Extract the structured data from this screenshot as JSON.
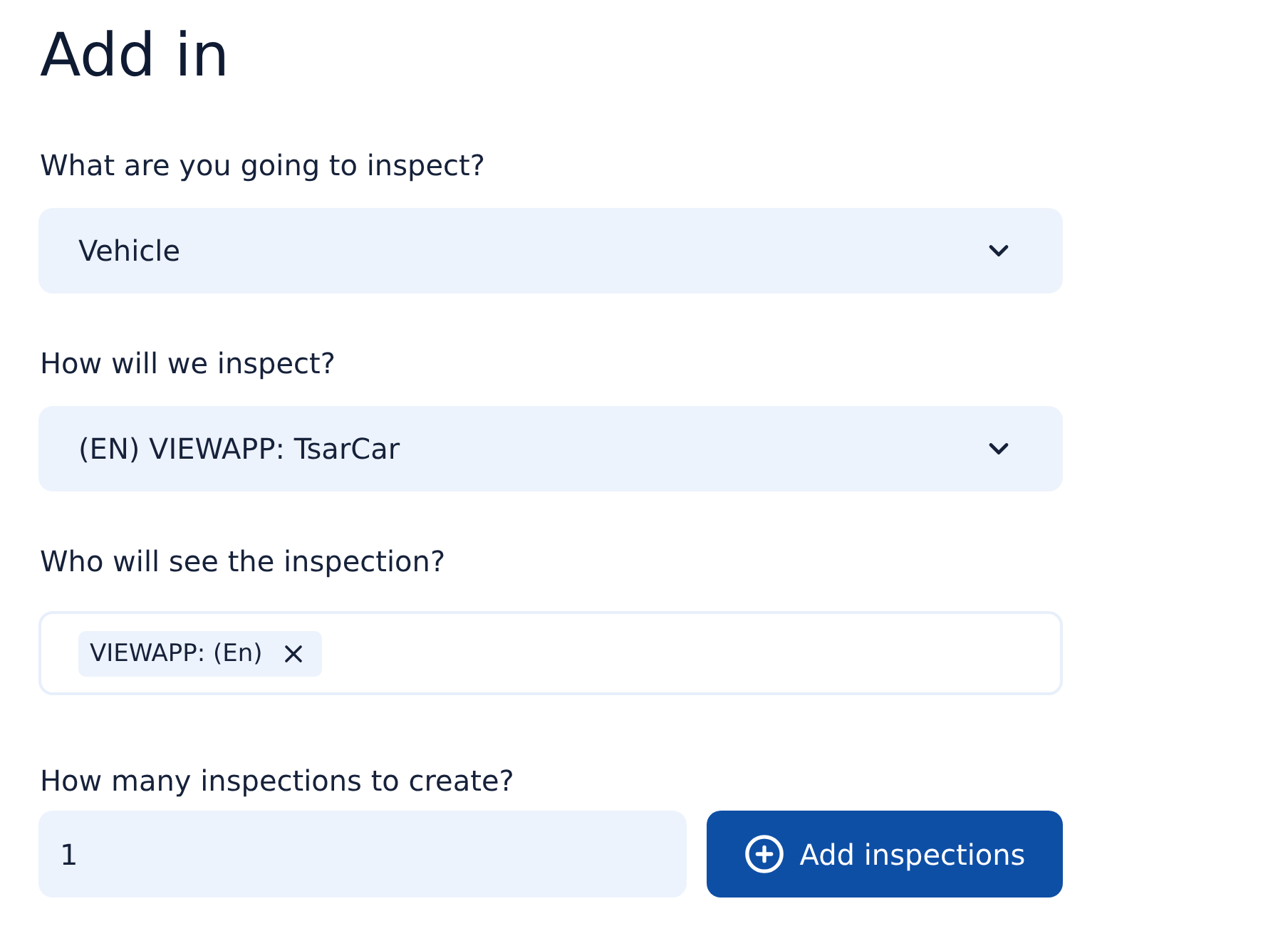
{
  "title": "Add in",
  "fields": [
    {
      "kind": "select",
      "label": "What are you going to inspect?",
      "value": "Vehicle"
    },
    {
      "kind": "select",
      "label": "How will we inspect?",
      "value": "(EN) VIEWAPP: TsarCar"
    },
    {
      "kind": "tags",
      "label": "Who will see the inspection?",
      "tags": [
        "VIEWAPP: (En)"
      ]
    },
    {
      "kind": "number",
      "label": "How many inspections to create?",
      "value": "1",
      "button": "Add inspections"
    }
  ]
}
